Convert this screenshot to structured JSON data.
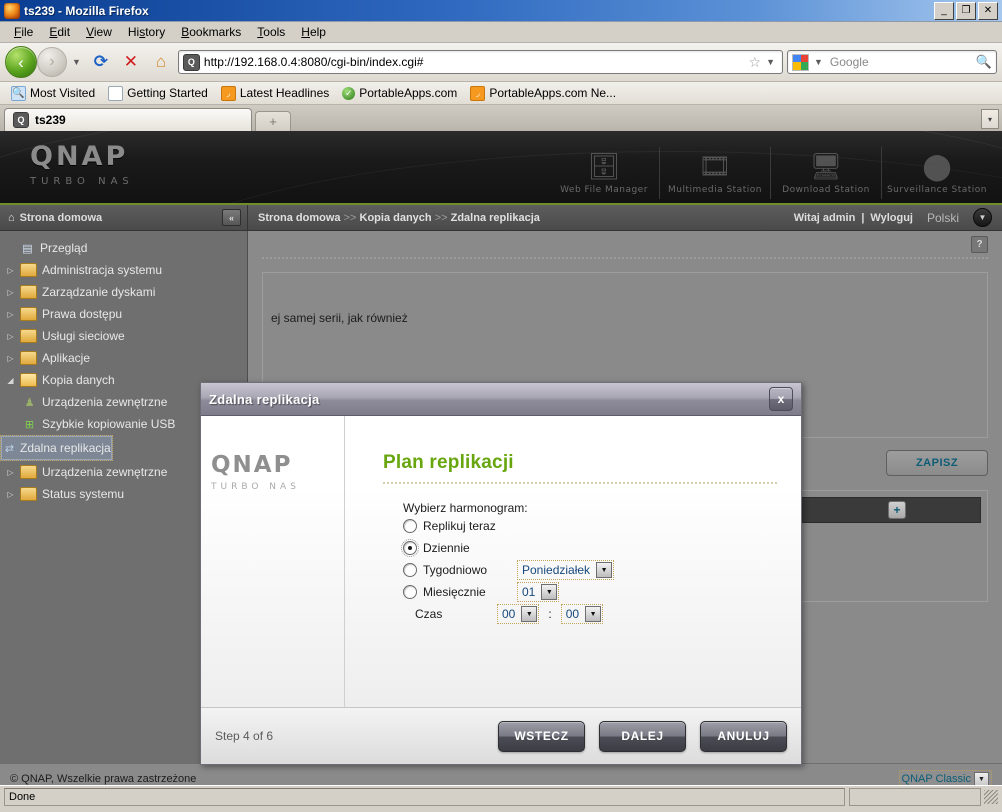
{
  "window": {
    "title": "ts239 - Mozilla Firefox",
    "icon": "firefox-icon",
    "minimize": "_",
    "maximize": "❐",
    "close": "✕"
  },
  "menubar": [
    "File",
    "Edit",
    "View",
    "History",
    "Bookmarks",
    "Tools",
    "Help"
  ],
  "toolbar": {
    "back_icon": "back-arrow-icon",
    "forward_icon": "forward-arrow-icon",
    "reload_icon": "reload-icon",
    "stop_icon": "stop-icon",
    "home_icon": "home-icon",
    "url": "http://192.168.0.4:8080/cgi-bin/index.cgi#",
    "star_icon": "bookmark-star-icon",
    "search_placeholder": "Google",
    "search_value": ""
  },
  "bookmarks": [
    {
      "label": "Most Visited",
      "icon": "most-visited-icon"
    },
    {
      "label": "Getting Started",
      "icon": "page-icon"
    },
    {
      "label": "Latest Headlines",
      "icon": "rss-icon"
    },
    {
      "label": "PortableApps.com",
      "icon": "portableapps-icon"
    },
    {
      "label": "PortableApps.com Ne...",
      "icon": "rss-icon"
    }
  ],
  "tabs": {
    "active": "ts239",
    "new_tab_label": "+",
    "list_all_label": "▾"
  },
  "qnap": {
    "logo": "QNAP",
    "logo_sub": "TURBO NAS",
    "apps": [
      {
        "label": "Web File Manager",
        "icon": "file-search-icon"
      },
      {
        "label": "Multimedia Station",
        "icon": "photo-film-icon"
      },
      {
        "label": "Download Station",
        "icon": "download-monitor-icon"
      },
      {
        "label": "Surveillance Station",
        "icon": "dome-camera-icon"
      }
    ],
    "home_label": "Strona domowa",
    "collapse_icon": "collapse-sidebar-icon",
    "breadcrumb": [
      "Strona domowa",
      "Kopia danych",
      "Zdalna replikacja"
    ],
    "breadcrumb_sep": ">>",
    "greeting": "Witaj admin",
    "greeting_sep": "|",
    "logout": "Wyloguj",
    "language": "Polski",
    "language_icon": "chevron-down-icon",
    "sidebar": [
      {
        "label": "Przegląd",
        "icon": "overview-icon",
        "twisty": "",
        "indent": 0,
        "selected": false
      },
      {
        "label": "Administracja systemu",
        "icon": "folder-icon",
        "twisty": "▷",
        "indent": 0,
        "selected": false
      },
      {
        "label": "Zarządzanie dyskami",
        "icon": "folder-icon",
        "twisty": "▷",
        "indent": 0,
        "selected": false
      },
      {
        "label": "Prawa dostępu",
        "icon": "folder-icon",
        "twisty": "▷",
        "indent": 0,
        "selected": false
      },
      {
        "label": "Usługi sieciowe",
        "icon": "folder-icon",
        "twisty": "▷",
        "indent": 0,
        "selected": false
      },
      {
        "label": "Aplikacje",
        "icon": "folder-icon",
        "twisty": "▷",
        "indent": 0,
        "selected": false
      },
      {
        "label": "Kopia danych",
        "icon": "folder-open-icon",
        "twisty": "◢",
        "indent": 0,
        "selected": false
      },
      {
        "label": "Urządzenia zewnętrzne",
        "icon": "usb-device-icon",
        "twisty": "",
        "indent": 1,
        "selected": false
      },
      {
        "label": "Szybkie kopiowanie USB",
        "icon": "usb-copy-icon",
        "twisty": "",
        "indent": 1,
        "selected": false
      },
      {
        "label": "Zdalna replikacja",
        "icon": "remote-replication-icon",
        "twisty": "",
        "indent": 1,
        "selected": true
      },
      {
        "label": "Urządzenia zewnętrzne",
        "icon": "folder-icon",
        "twisty": "▷",
        "indent": 0,
        "selected": false
      },
      {
        "label": "Status systemu",
        "icon": "folder-icon",
        "twisty": "▷",
        "indent": 0,
        "selected": false
      }
    ],
    "main": {
      "help_label": "?",
      "panel_text": "ej samej serii, jak również",
      "save_label": "ZAPISZ",
      "add_label": "+"
    },
    "footer": {
      "copyright": "© QNAP, Wszelkie prawa zastrzeżone",
      "theme": "QNAP Classic",
      "theme_icon": "chevron-down-icon"
    }
  },
  "dialog": {
    "title": "Zdalna replikacja",
    "close_label": "x",
    "logo": "QNAP",
    "logo_sub": "TURBO NAS",
    "heading": "Plan replikacji",
    "section_label": "Wybierz harmonogram:",
    "options": [
      {
        "label": "Replikuj teraz",
        "selected": false,
        "control": null
      },
      {
        "label": "Dziennie",
        "selected": true,
        "control": null
      },
      {
        "label": "Tygodniowo",
        "selected": false,
        "control": {
          "value": "Poniedziałek",
          "icon": "chevron-down-icon"
        }
      },
      {
        "label": "Miesięcznie",
        "selected": false,
        "control": {
          "value": "01",
          "icon": "chevron-down-icon"
        }
      }
    ],
    "time_label": "Czas",
    "time_hour": "00",
    "time_sep": ":",
    "time_minute": "00",
    "step": "Step 4 of 6",
    "buttons": [
      {
        "label": "WSTECZ",
        "name": "back"
      },
      {
        "label": "DALEJ",
        "name": "next"
      },
      {
        "label": "ANULUJ",
        "name": "cancel"
      }
    ]
  },
  "statusbar": {
    "text": "Done",
    "progress": ""
  },
  "colors": {
    "accent_green": "#67a60f",
    "link_blue": "#16487d",
    "banner_dark": "#1a1a1a",
    "selected_row": "#7d8795"
  }
}
